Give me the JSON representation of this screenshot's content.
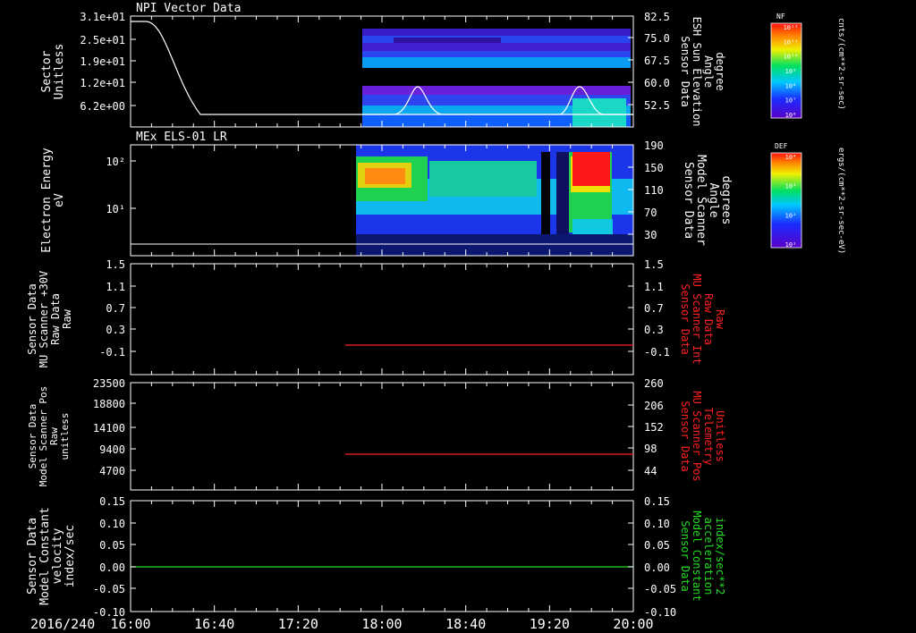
{
  "date_label": "2016/240",
  "time_ticks": [
    "16:00",
    "16:40",
    "17:20",
    "18:00",
    "18:40",
    "19:20",
    "20:00"
  ],
  "panels": [
    {
      "title": "NPI Vector Data",
      "left_label": [
        "Sector",
        "Unitless"
      ],
      "left_ticks": [
        "3.1e+01",
        "2.5e+01",
        "1.9e+01",
        "1.2e+01",
        "6.2e+00"
      ],
      "right_label": [
        "Sensor Data",
        "ESH Sun Elevation",
        "Angle",
        "degree"
      ],
      "right_ticks": [
        "82.5",
        "75.0",
        "67.5",
        "60.0",
        "52.5"
      ],
      "right_label_color": "#ffffff"
    },
    {
      "title": "MEx ELS-01 LR",
      "left_label": [
        "Electron Energy",
        "eV"
      ],
      "left_ticks": [
        "10²",
        "10¹"
      ],
      "right_label": [
        "Sensor Data",
        "Model Scanner",
        "Angle",
        "degrees"
      ],
      "right_ticks": [
        "190",
        "150",
        "110",
        "70",
        "30"
      ],
      "right_label_color": "#ffffff"
    },
    {
      "title": "",
      "left_label": [
        "Sensor Data",
        "MU Scanner +30V",
        "Raw Data",
        "Raw"
      ],
      "left_ticks": [
        "1.5",
        "1.1",
        "0.7",
        "0.3",
        "-0.1"
      ],
      "right_label": [
        "Sensor Data",
        "MU Scanner Int",
        "Raw Data",
        "Raw"
      ],
      "right_ticks": [
        "1.5",
        "1.1",
        "0.7",
        "0.3",
        "-0.1"
      ],
      "right_label_color": "#ff2020"
    },
    {
      "title": "",
      "left_label": [
        "Sensor Data",
        "Model Scanner Pos",
        "Raw",
        "unitless"
      ],
      "left_ticks": [
        "23500",
        "18800",
        "14100",
        "9400",
        "4700"
      ],
      "right_label": [
        "Sensor Data",
        "MU Scanner Pos",
        "Telemetry",
        "Unitless"
      ],
      "right_ticks": [
        "260",
        "206",
        "152",
        "98",
        "44"
      ],
      "right_label_color": "#ff2020"
    },
    {
      "title": "",
      "left_label": [
        "Sensor Data",
        "Model Constant",
        "velocity",
        "index/sec"
      ],
      "left_ticks": [
        "0.15",
        "0.10",
        "0.05",
        "0.00",
        "-0.05",
        "-0.10"
      ],
      "right_label": [
        "Sensor Data",
        "Model Constant",
        "acceleration",
        "index/sec**2"
      ],
      "right_ticks": [
        "0.15",
        "0.10",
        "0.05",
        "0.00",
        "-0.05",
        "-0.10"
      ],
      "right_label_color": "#22dd22"
    }
  ],
  "colorbars": [
    {
      "header": "NF",
      "unit": "cnts/(cm**2-sr-sec)",
      "ticks": [
        "10¹²",
        "10¹¹",
        "10¹⁰",
        "10⁹",
        "10⁸",
        "10⁷",
        "10⁶"
      ]
    },
    {
      "header": "DEF",
      "unit": "ergs/(cm**2-sr-sec-eV)",
      "ticks": [
        "10⁴",
        "10³",
        "10²",
        "10¹"
      ]
    }
  ],
  "chart_data": [
    {
      "type": "line",
      "title": "NPI Vector Data",
      "ylabel": "Sector Unitless",
      "ylim": [
        0,
        31
      ],
      "x": [
        "16:00",
        "16:05",
        "16:12",
        "16:20",
        "16:30",
        "16:37",
        "16:40",
        "17:00",
        "17:20",
        "17:44",
        "18:00",
        "18:20",
        "18:40",
        "19:00",
        "19:20",
        "19:35",
        "19:45",
        "20:00"
      ],
      "series": [
        {
          "values": [
            31,
            31,
            29,
            22,
            11,
            4,
            3,
            3,
            3,
            3,
            3,
            3,
            3,
            3,
            3,
            3,
            3,
            3
          ]
        }
      ],
      "secondary_series": {
        "ylabel": "Sensor Data ESH Sun Elevation Angle degree",
        "ylim": [
          45,
          85
        ],
        "x": [
          "17:44",
          "18:05",
          "18:10",
          "18:15",
          "18:20",
          "18:25",
          "19:25",
          "19:30",
          "19:35",
          "19:40",
          "19:45"
        ],
        "values": [
          47,
          47,
          52,
          58,
          52,
          47,
          47,
          52,
          58,
          52,
          47
        ]
      }
    },
    {
      "type": "heatmap",
      "title": "MEx ELS-01 LR",
      "ylabel": "Electron Energy eV",
      "y_scale": "log",
      "data_start": "17:44",
      "data_end": "20:00",
      "reference_line": {
        "label": "Sensor Data Model Scanner Angle degrees",
        "value": 10
      }
    },
    {
      "type": "line",
      "ylabel": "Sensor Data MU Scanner +30V Raw Data Raw",
      "ylim": [
        -0.3,
        1.5
      ],
      "series": [
        {
          "x": [
            "17:35",
            "20:00"
          ],
          "values": [
            0.0,
            0.0
          ]
        }
      ]
    },
    {
      "type": "line",
      "ylabel": "Sensor Data Model Scanner Pos Raw unitless",
      "ylim": [
        0,
        23500
      ],
      "series": [
        {
          "x": [
            "17:35",
            "20:00"
          ],
          "values": [
            8000,
            8000
          ]
        }
      ]
    },
    {
      "type": "line",
      "ylabel": "Sensor Data Model Constant velocity index/sec",
      "ylim": [
        -0.1,
        0.15
      ],
      "series": [
        {
          "x": [
            "16:00",
            "20:00"
          ],
          "values": [
            0.0,
            0.0
          ]
        }
      ]
    }
  ]
}
